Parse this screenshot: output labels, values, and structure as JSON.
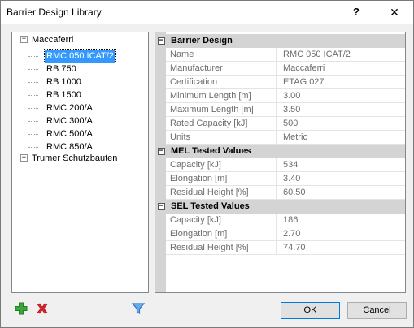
{
  "window": {
    "title": "Barrier Design Library",
    "help_label": "?",
    "close_label": "✕"
  },
  "tree": {
    "root_expander": "−",
    "root": "Maccaferri",
    "children": [
      "RMC 050 ICAT/2",
      "RB 750",
      "RB 1000",
      "RB 1500",
      "RMC 200/A",
      "RMC 300/A",
      "RMC 500/A",
      "RMC 850/A"
    ],
    "selected_index": 0,
    "second_root_expander": "+",
    "second_root": "Trumer Schutzbauten"
  },
  "grid": {
    "categories": [
      {
        "name": "Barrier Design",
        "expander": "−",
        "props": [
          {
            "name": "Name",
            "value": "RMC 050 ICAT/2"
          },
          {
            "name": "Manufacturer",
            "value": "Maccaferri"
          },
          {
            "name": "Certification",
            "value": "ETAG 027"
          },
          {
            "name": "Minimum Length [m]",
            "value": "3.00"
          },
          {
            "name": "Maximum Length [m]",
            "value": "3.50"
          },
          {
            "name": "Rated Capacity [kJ]",
            "value": "500"
          },
          {
            "name": "Units",
            "value": "Metric"
          }
        ]
      },
      {
        "name": "MEL Tested Values",
        "expander": "−",
        "props": [
          {
            "name": "Capacity [kJ]",
            "value": "534"
          },
          {
            "name": "Elongation [m]",
            "value": "3.40"
          },
          {
            "name": "Residual Height [%]",
            "value": "60.50"
          }
        ]
      },
      {
        "name": "SEL Tested Values",
        "expander": "−",
        "props": [
          {
            "name": "Capacity [kJ]",
            "value": "186"
          },
          {
            "name": "Elongation [m]",
            "value": "2.70"
          },
          {
            "name": "Residual Height [%]",
            "value": "74.70"
          }
        ]
      }
    ]
  },
  "toolbar": {
    "add_icon": "plus-icon",
    "delete_icon": "x-icon",
    "filter_icon": "funnel-icon",
    "add_color": "#3aa836",
    "delete_color": "#d8232a",
    "filter_color": "#2e78c8"
  },
  "buttons": {
    "ok_label": "OK",
    "cancel_label": "Cancel"
  }
}
